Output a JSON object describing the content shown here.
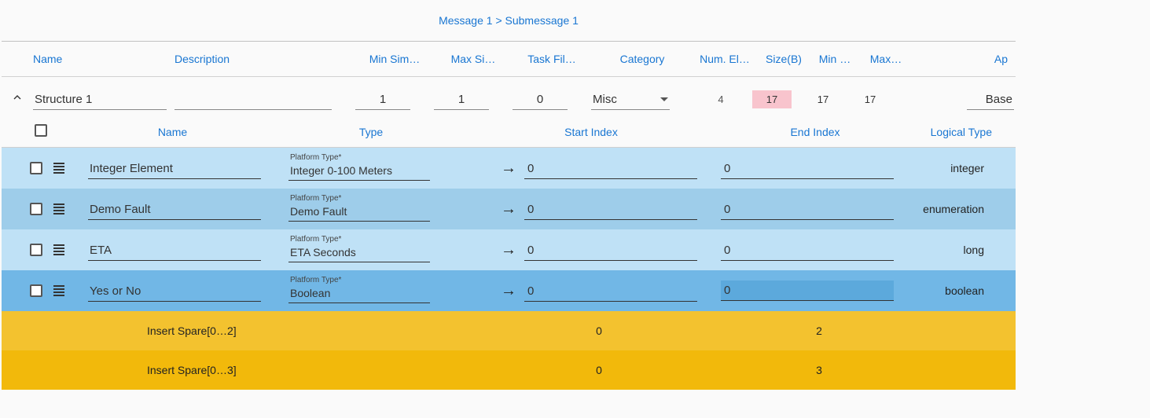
{
  "breadcrumb": {
    "a": "Message 1",
    "sep": ">",
    "b": "Submessage 1"
  },
  "outerHeaders": {
    "name": "Name",
    "desc": "Description",
    "minSim": "Min Sim…",
    "maxSi": "Max Si…",
    "task": "Task Fil…",
    "category": "Category",
    "numEl": "Num. El…",
    "size": "Size(B)",
    "min": "Min …",
    "max": "Max…",
    "ap": "Ap"
  },
  "structure": {
    "name": "Structure 1",
    "description": "",
    "minSim": "1",
    "maxSi": "1",
    "task": "0",
    "category": "Misc",
    "numEl": "4",
    "size": "17",
    "min": "17",
    "max": "17",
    "taxonomy": "Base"
  },
  "innerHeaders": {
    "name": "Name",
    "type": "Type",
    "start": "Start Index",
    "end": "End Index",
    "logical": "Logical Type"
  },
  "typeFieldLabel": "Platform Type*",
  "elements": [
    {
      "name": "Integer Element",
      "type": "Integer 0-100 Meters",
      "start": "0",
      "end": "0",
      "logical": "integer"
    },
    {
      "name": "Demo Fault",
      "type": "Demo Fault",
      "start": "0",
      "end": "0",
      "logical": "enumeration"
    },
    {
      "name": "ETA",
      "type": "ETA Seconds",
      "start": "0",
      "end": "0",
      "logical": "long"
    },
    {
      "name": "Yes or No",
      "type": "Boolean",
      "start": "0",
      "end": "0",
      "logical": "boolean"
    }
  ],
  "arrowGlyph": "→",
  "spares": [
    {
      "name": "Insert Spare[0…2]",
      "start": "0",
      "end": "2"
    },
    {
      "name": "Insert Spare[0…3]",
      "start": "0",
      "end": "3"
    }
  ]
}
